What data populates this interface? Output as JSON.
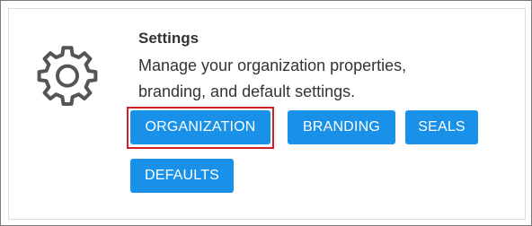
{
  "settings": {
    "title": "Settings",
    "description": "Manage your organization properties, branding, and default settings.",
    "icon": "gear-icon"
  },
  "buttons": [
    {
      "label": "ORGANIZATION",
      "highlighted": true
    },
    {
      "label": "BRANDING"
    },
    {
      "label": "SEALS"
    },
    {
      "label": "DEFAULTS"
    }
  ],
  "colors": {
    "button_bg": "#1a91e8",
    "button_text": "#ffffff",
    "highlight_border": "#d21f2b",
    "text": "#333333"
  }
}
